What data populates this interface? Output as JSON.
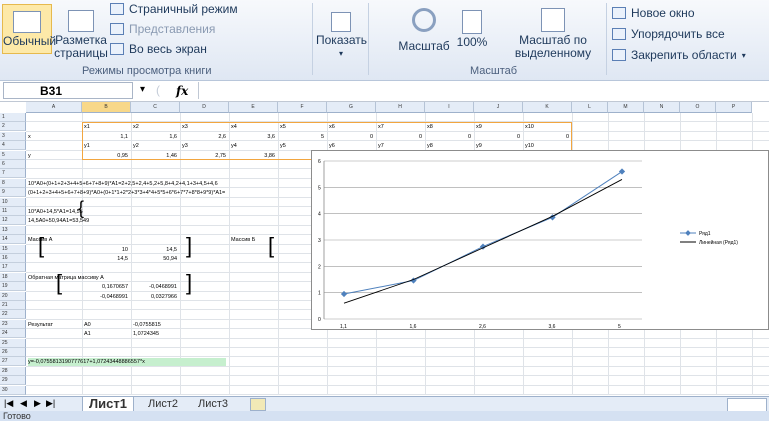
{
  "ribbon": {
    "normal_label": "Обычный",
    "page_layout_line1": "Разметка",
    "page_layout_line2": "страницы",
    "page_mode": "Страничный режим",
    "representations": "Представления",
    "full_screen": "Во весь экран",
    "view_modes_label": "Режимы просмотра книги",
    "show_label": "Показать",
    "zoom_label": "Масштаб",
    "zoom_100": "100%",
    "zoom_sel_line1": "Масштаб по",
    "zoom_sel_line2": "выделенному",
    "zoom_group_label": "Масштаб",
    "new_window": "Новое окно",
    "arrange_all": "Упорядочить все",
    "freeze_panes": "Закрепить области"
  },
  "formula_bar": {
    "cell_ref": "B31",
    "fx": "fx",
    "content": ""
  },
  "columns": [
    "A",
    "B",
    "C",
    "D",
    "E",
    "F",
    "G",
    "H",
    "I",
    "J",
    "K",
    "L",
    "M",
    "N",
    "O",
    "P"
  ],
  "rows": [
    "1",
    "2",
    "3",
    "4",
    "5",
    "6",
    "7",
    "8",
    "9",
    "10",
    "11",
    "12",
    "13",
    "14",
    "15",
    "16",
    "17",
    "18",
    "19",
    "20",
    "21",
    "22",
    "23",
    "24",
    "25",
    "26",
    "27",
    "28",
    "29",
    "30"
  ],
  "cells": {
    "r2": [
      "x1",
      "x2",
      "x3",
      "x4",
      "x5",
      "x6",
      "x7",
      "x8",
      "x9",
      "x10"
    ],
    "r3_label": "x",
    "r3": [
      "1,1",
      "1,6",
      "2,6",
      "3,6",
      "5",
      "0",
      "0",
      "0",
      "0",
      "0"
    ],
    "r4": [
      "y1",
      "y2",
      "y3",
      "y4",
      "y5",
      "y6",
      "y7",
      "y8",
      "y9",
      "y10"
    ],
    "r5_label": "y",
    "r5": [
      "0,95",
      "1,46",
      "2,75",
      "3,86",
      "5"
    ],
    "r8": "10*A0+(0+1+2+3+4+5+6+7+8+9)*A1=2+2,5+2,4+5,2+5,8+4,2+4,1+3+4,5+4,6",
    "r9": "(0+1+2+3+4+5+6+7+8+9)*A0+(0+1*1+2*2+3*3+4*4+5*5+6*6+7*7+8*8+9*9)*A1=",
    "r11": "10*A0+14,5*A1=14,55",
    "r12": "14,5A0+50,94A1=53,549",
    "r14_a": "Массив А",
    "r14_e": "Массив Б",
    "r15": [
      "10",
      "14,5"
    ],
    "r15_e": "14",
    "r16": [
      "14,5",
      "50,94"
    ],
    "r16_e": "53,",
    "r18": "Обратная матрица массиву А",
    "r19": [
      "0,1670657",
      "-0,0468991"
    ],
    "r20": [
      "-0,0468991",
      "0,0327966"
    ],
    "r23_label": "Результат",
    "r23_a0": "A0",
    "r23_val": "-0,0755815",
    "r24_a1": "A1",
    "r24_val": "1,0724345",
    "r27": "y=-0,0755813190777617+1,07243448886557*x"
  },
  "sheets": [
    "Лист1",
    "Лист2",
    "Лист3"
  ],
  "active_sheet": "Лист1",
  "status": "Готово",
  "chart_data": {
    "type": "scatter",
    "x": [
      "1,1",
      "1,6",
      "2,6",
      "3,6",
      "5"
    ],
    "series": [
      {
        "name": "Ряд1",
        "values": [
          0.95,
          1.46,
          2.75,
          3.86,
          5.6
        ],
        "color": "#4f81bd"
      },
      {
        "name": "Линейная (Ряд1)",
        "values": [
          0.6,
          1.5,
          2.7,
          3.9,
          5.3
        ],
        "color": "#000000"
      }
    ],
    "yticks": [
      "0",
      "1",
      "2",
      "3",
      "4",
      "5",
      "6"
    ],
    "ylim": [
      0,
      6
    ]
  }
}
